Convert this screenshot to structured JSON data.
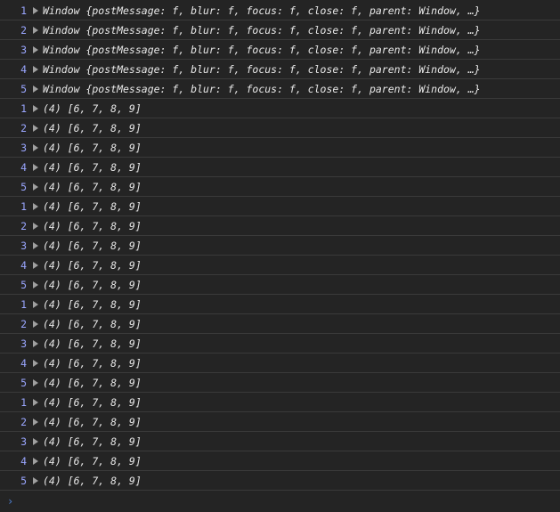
{
  "console": {
    "window_rows": [
      {
        "count": "1",
        "text": "Window {postMessage: f, blur: f, focus: f, close: f, parent: Window, …}"
      },
      {
        "count": "2",
        "text": "Window {postMessage: f, blur: f, focus: f, close: f, parent: Window, …}"
      },
      {
        "count": "3",
        "text": "Window {postMessage: f, blur: f, focus: f, close: f, parent: Window, …}"
      },
      {
        "count": "4",
        "text": "Window {postMessage: f, blur: f, focus: f, close: f, parent: Window, …}"
      },
      {
        "count": "5",
        "text": "Window {postMessage: f, blur: f, focus: f, close: f, parent: Window, …}"
      }
    ],
    "array_rows": [
      {
        "count": "1",
        "text": "(4) [6, 7, 8, 9]"
      },
      {
        "count": "2",
        "text": "(4) [6, 7, 8, 9]"
      },
      {
        "count": "3",
        "text": "(4) [6, 7, 8, 9]"
      },
      {
        "count": "4",
        "text": "(4) [6, 7, 8, 9]"
      },
      {
        "count": "5",
        "text": "(4) [6, 7, 8, 9]"
      },
      {
        "count": "1",
        "text": "(4) [6, 7, 8, 9]"
      },
      {
        "count": "2",
        "text": "(4) [6, 7, 8, 9]"
      },
      {
        "count": "3",
        "text": "(4) [6, 7, 8, 9]"
      },
      {
        "count": "4",
        "text": "(4) [6, 7, 8, 9]"
      },
      {
        "count": "5",
        "text": "(4) [6, 7, 8, 9]"
      },
      {
        "count": "1",
        "text": "(4) [6, 7, 8, 9]"
      },
      {
        "count": "2",
        "text": "(4) [6, 7, 8, 9]"
      },
      {
        "count": "3",
        "text": "(4) [6, 7, 8, 9]"
      },
      {
        "count": "4",
        "text": "(4) [6, 7, 8, 9]"
      },
      {
        "count": "5",
        "text": "(4) [6, 7, 8, 9]"
      },
      {
        "count": "1",
        "text": "(4) [6, 7, 8, 9]"
      },
      {
        "count": "2",
        "text": "(4) [6, 7, 8, 9]"
      },
      {
        "count": "3",
        "text": "(4) [6, 7, 8, 9]"
      },
      {
        "count": "4",
        "text": "(4) [6, 7, 8, 9]"
      },
      {
        "count": "5",
        "text": "(4) [6, 7, 8, 9]"
      }
    ],
    "prompt_icon": "prompt-chevron-icon",
    "colors": {
      "background": "#242424",
      "count": "#9aa6ff",
      "prompt": "#4d7fd1"
    }
  }
}
